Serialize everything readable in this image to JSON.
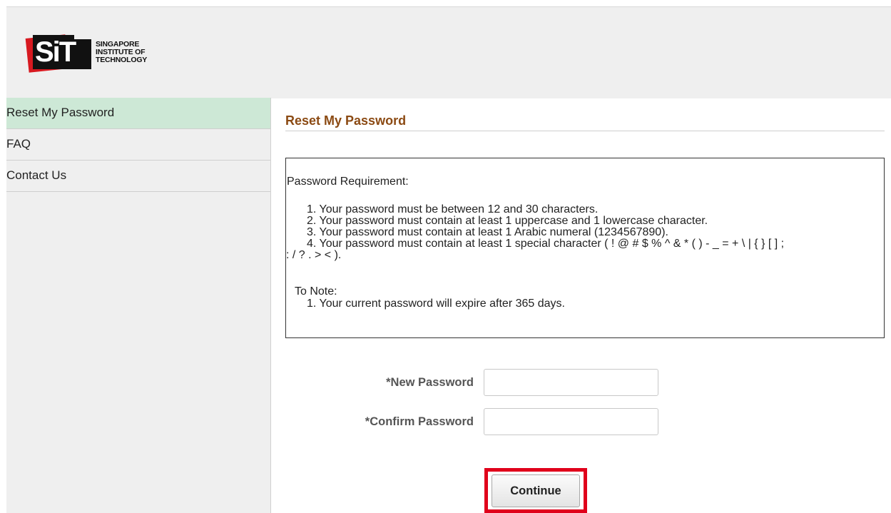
{
  "header": {
    "logo_letters": "SiT",
    "logo_text_lines": [
      "SINGAPORE",
      "INSTITUTE OF",
      "TECHNOLOGY"
    ]
  },
  "sidebar": {
    "items": [
      {
        "label": "Reset My Password",
        "active": true
      },
      {
        "label": "FAQ",
        "active": false
      },
      {
        "label": "Contact Us",
        "active": false
      }
    ]
  },
  "main": {
    "title": "Reset My Password",
    "requirements": {
      "heading": "Password Requirement:",
      "lines": [
        "1. Your password must be between 12 and 30 characters.",
        "2. Your password must contain at least 1 uppercase and 1 lowercase character.",
        "3. Your password must contain at least 1 Arabic numeral (1234567890).",
        "4. Your password must contain at least 1 special character ( ! @ # $ % ^ & * ( ) - _ = + \\ | { } [ ] ;",
        ": / ? . > < )."
      ],
      "note_heading": "To Note:",
      "note_line": "1. Your current password will expire after 365 days."
    },
    "form": {
      "new_password_label": "*New Password",
      "new_password_value": "",
      "confirm_password_label": "*Confirm Password",
      "confirm_password_value": "",
      "continue_label": "Continue"
    }
  },
  "colors": {
    "title": "#8b4a13",
    "active_nav": "#cde8d6",
    "highlight_border": "#e0001b",
    "background_panel": "#efefef"
  }
}
